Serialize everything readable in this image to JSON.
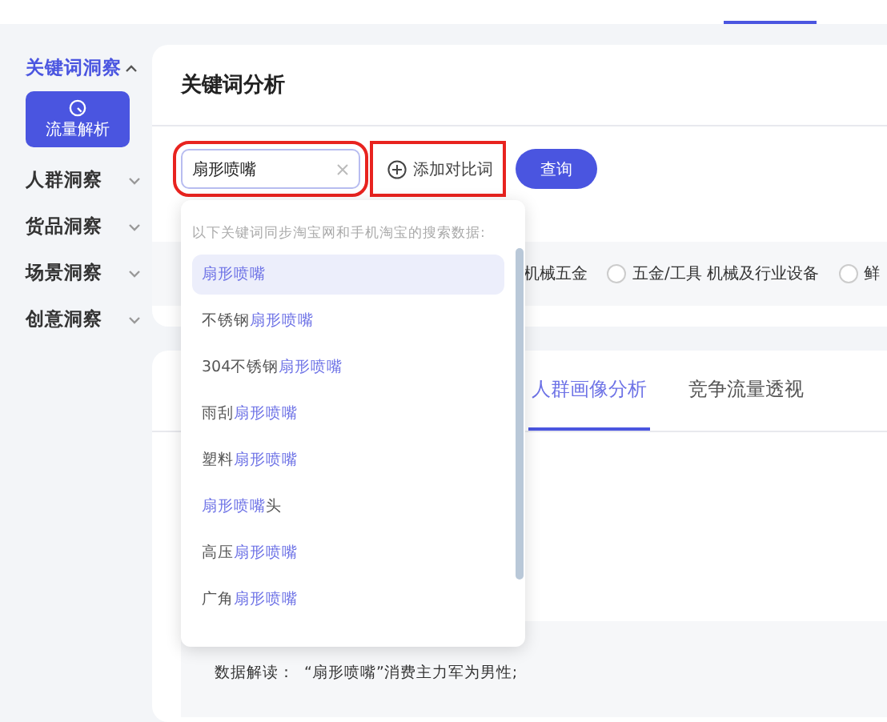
{
  "top_nav": {
    "active_indicator": true
  },
  "sidebar": {
    "groups": [
      {
        "label": "关键词洞察",
        "expanded": true,
        "children": [
          {
            "label": "流量解析",
            "selected": true
          }
        ]
      },
      {
        "label": "人群洞察",
        "expanded": false
      },
      {
        "label": "货品洞察",
        "expanded": false
      },
      {
        "label": "场景洞察",
        "expanded": false
      },
      {
        "label": "创意洞察",
        "expanded": false
      }
    ]
  },
  "keyword_panel": {
    "title": "关键词分析",
    "search": {
      "value": "扇形喷嘴",
      "annotated": true
    },
    "add_compare": {
      "label": "添加对比词",
      "annotated": true
    },
    "query_button": "查询",
    "categories": [
      {
        "label": "机械五金",
        "selected": false,
        "kind": "text"
      },
      {
        "label": "五金/工具 机械及行业设备",
        "selected": false,
        "kind": "radio"
      },
      {
        "label": "鲜",
        "selected": false,
        "kind": "radio"
      }
    ]
  },
  "suggestions": {
    "note": "以下关键词同步淘宝网和手机淘宝的搜索数据:",
    "items": [
      {
        "selected": true,
        "parts": [
          {
            "text": "扇形喷嘴",
            "match": true
          }
        ]
      },
      {
        "selected": false,
        "parts": [
          {
            "text": "不锈钢",
            "match": false
          },
          {
            "text": "扇形喷嘴",
            "match": true
          }
        ]
      },
      {
        "selected": false,
        "parts": [
          {
            "text": "304不锈钢",
            "match": false
          },
          {
            "text": "扇形喷嘴",
            "match": true
          }
        ]
      },
      {
        "selected": false,
        "parts": [
          {
            "text": "雨刮",
            "match": false
          },
          {
            "text": "扇形喷嘴",
            "match": true
          }
        ]
      },
      {
        "selected": false,
        "parts": [
          {
            "text": "塑料",
            "match": false
          },
          {
            "text": "扇形喷嘴",
            "match": true
          }
        ]
      },
      {
        "selected": false,
        "parts": [
          {
            "text": "扇形喷嘴",
            "match": true
          },
          {
            "text": "头",
            "match": false
          }
        ]
      },
      {
        "selected": false,
        "parts": [
          {
            "text": "高压",
            "match": false
          },
          {
            "text": "扇形喷嘴",
            "match": true
          }
        ]
      },
      {
        "selected": false,
        "parts": [
          {
            "text": "广角",
            "match": false
          },
          {
            "text": "扇形喷嘴",
            "match": true
          }
        ]
      }
    ]
  },
  "analysis": {
    "tabs": [
      {
        "label": "人群画像分析",
        "selected": true
      },
      {
        "label": "竞争流量透视",
        "selected": false
      }
    ],
    "insight": "数据解读：  “扇形喷嘴”消费主力军为男性;"
  }
}
